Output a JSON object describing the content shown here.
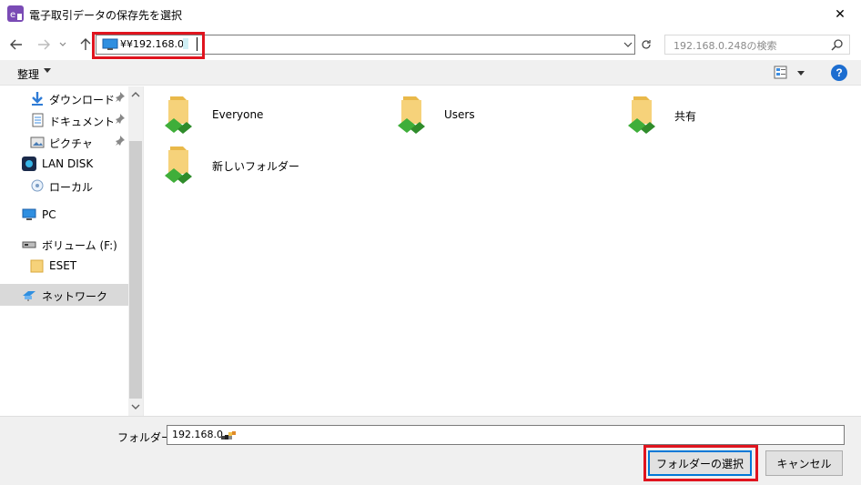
{
  "window": {
    "title": "電子取引データの保存先を選択",
    "close_glyph": "✕"
  },
  "navigation": {
    "address_value": "¥¥192.168.0.",
    "search_placeholder": "192.168.0.248の検索"
  },
  "toolbar": {
    "organize_label": "整理",
    "help_glyph": "?"
  },
  "sidebar": {
    "items": [
      {
        "label": "ダウンロード",
        "icon": "download-icon",
        "pinned": true
      },
      {
        "label": "ドキュメント",
        "icon": "document-icon",
        "pinned": true
      },
      {
        "label": "ピクチャ",
        "icon": "pictures-icon",
        "pinned": true
      },
      {
        "label": "LAN DISK",
        "icon": "lan-disk-icon",
        "pinned": false
      },
      {
        "label": "ローカル",
        "icon": "local-icon",
        "pinned": false
      },
      {
        "label": "PC",
        "icon": "pc-icon",
        "pinned": false
      },
      {
        "label": "ボリューム (F:)",
        "icon": "drive-icon",
        "pinned": false
      },
      {
        "label": "ESET",
        "icon": "folder-icon",
        "pinned": false
      },
      {
        "label": "ネットワーク",
        "icon": "network-icon",
        "pinned": false,
        "selected": true
      }
    ]
  },
  "content": {
    "folders": [
      {
        "label": "Everyone",
        "icon": "shared-folder-icon"
      },
      {
        "label": "Users",
        "icon": "shared-folder-icon"
      },
      {
        "label": "共有",
        "icon": "shared-folder-icon"
      },
      {
        "label": "新しいフォルダー",
        "icon": "shared-folder-icon"
      }
    ]
  },
  "footer": {
    "folder_label": "フォルダー:",
    "folder_value": "192.168.0.",
    "select_button": "フォルダーの選択",
    "cancel_button": "キャンセル"
  },
  "colors": {
    "highlight_red": "#e0141e",
    "accent_blue": "#0078d7",
    "selected_row": "#d9d9d9",
    "folder_yellow": "#f6d27a",
    "share_green": "#3fae3a"
  }
}
